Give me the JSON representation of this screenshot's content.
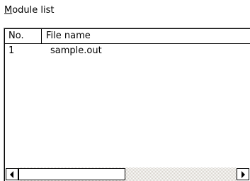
{
  "module_list": {
    "label_mnemonic": "M",
    "label_rest": "odule list",
    "columns": {
      "no": "No.",
      "file_name": "File name"
    },
    "rows": [
      {
        "no": "1",
        "file_name": "sample.out"
      }
    ]
  },
  "scrollbar": {
    "left_icon": "arrow-left-icon",
    "right_icon": "arrow-right-icon"
  }
}
